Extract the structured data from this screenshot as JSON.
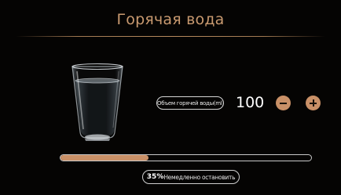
{
  "header": {
    "title": "Горячая вода"
  },
  "product": {
    "icon": "glass-of-water-icon"
  },
  "volume": {
    "label": "Объем горячей воды(ml)",
    "value": "100",
    "unit": "ml"
  },
  "controls": {
    "decrease_icon": "minus-icon",
    "increase_icon": "plus-icon"
  },
  "progress": {
    "percent": 35,
    "percent_label": "35%"
  },
  "stop": {
    "label": "Немедленно остановить"
  },
  "colors": {
    "accent": "#c99067",
    "title": "#c99a70",
    "background": "#050403"
  }
}
